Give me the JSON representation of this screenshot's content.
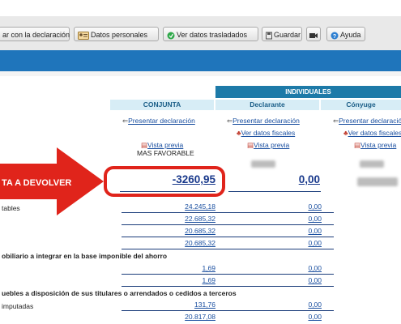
{
  "toolbar": {
    "buttons": [
      {
        "label": "ar con la declaración",
        "icon": "send-icon"
      },
      {
        "label": "Datos personales",
        "icon": "person-card-icon"
      },
      {
        "label": "Ver datos trasladados",
        "icon": "green-circle-icon"
      },
      {
        "label": "Guardar",
        "icon": "save-icon"
      },
      {
        "label": "",
        "icon": "camera-icon"
      },
      {
        "label": "Ayuda",
        "icon": "help-icon"
      }
    ]
  },
  "table": {
    "group_header": "INDIVIDUALES",
    "columns": [
      "CONJUNTA",
      "Declarante",
      "Cónyuge"
    ],
    "present_link": "Presentar declaración",
    "fiscal_link": "Ver datos fiscales",
    "preview_link": "Vista previa",
    "favorable": "MAS FAVORABLE",
    "result_label": "TA A DEVOLVER",
    "result_conjunta": "-3260,95",
    "result_declarante": "0,00"
  },
  "rows": [
    {
      "label": "tables",
      "conjunta": "24.245,18",
      "declarante": "0,00"
    },
    {
      "label": "",
      "conjunta": "22.685,32",
      "declarante": "0,00"
    },
    {
      "label": "",
      "conjunta": "20.685,32",
      "declarante": "0,00"
    },
    {
      "label": "",
      "conjunta": "20.685,32",
      "declarante": "0,00"
    }
  ],
  "section1": {
    "title": "obiliario a integrar en la base imponible del ahorro",
    "rows": [
      {
        "conjunta": "1,69",
        "declarante": "0,00"
      },
      {
        "conjunta": "1,69",
        "declarante": "0,00"
      }
    ]
  },
  "section2": {
    "title": "uebles a disposición de sus titulares o arrendados o cedidos a terceros",
    "rows": [
      {
        "label": "imputadas",
        "conjunta": "131,76",
        "declarante": "0,00"
      },
      {
        "label": "",
        "conjunta": "20.817,08",
        "declarante": "0,00"
      }
    ]
  },
  "colors": {
    "accent": "#1f75bb",
    "highlight": "#e0241b",
    "link": "#1a4fa0"
  }
}
